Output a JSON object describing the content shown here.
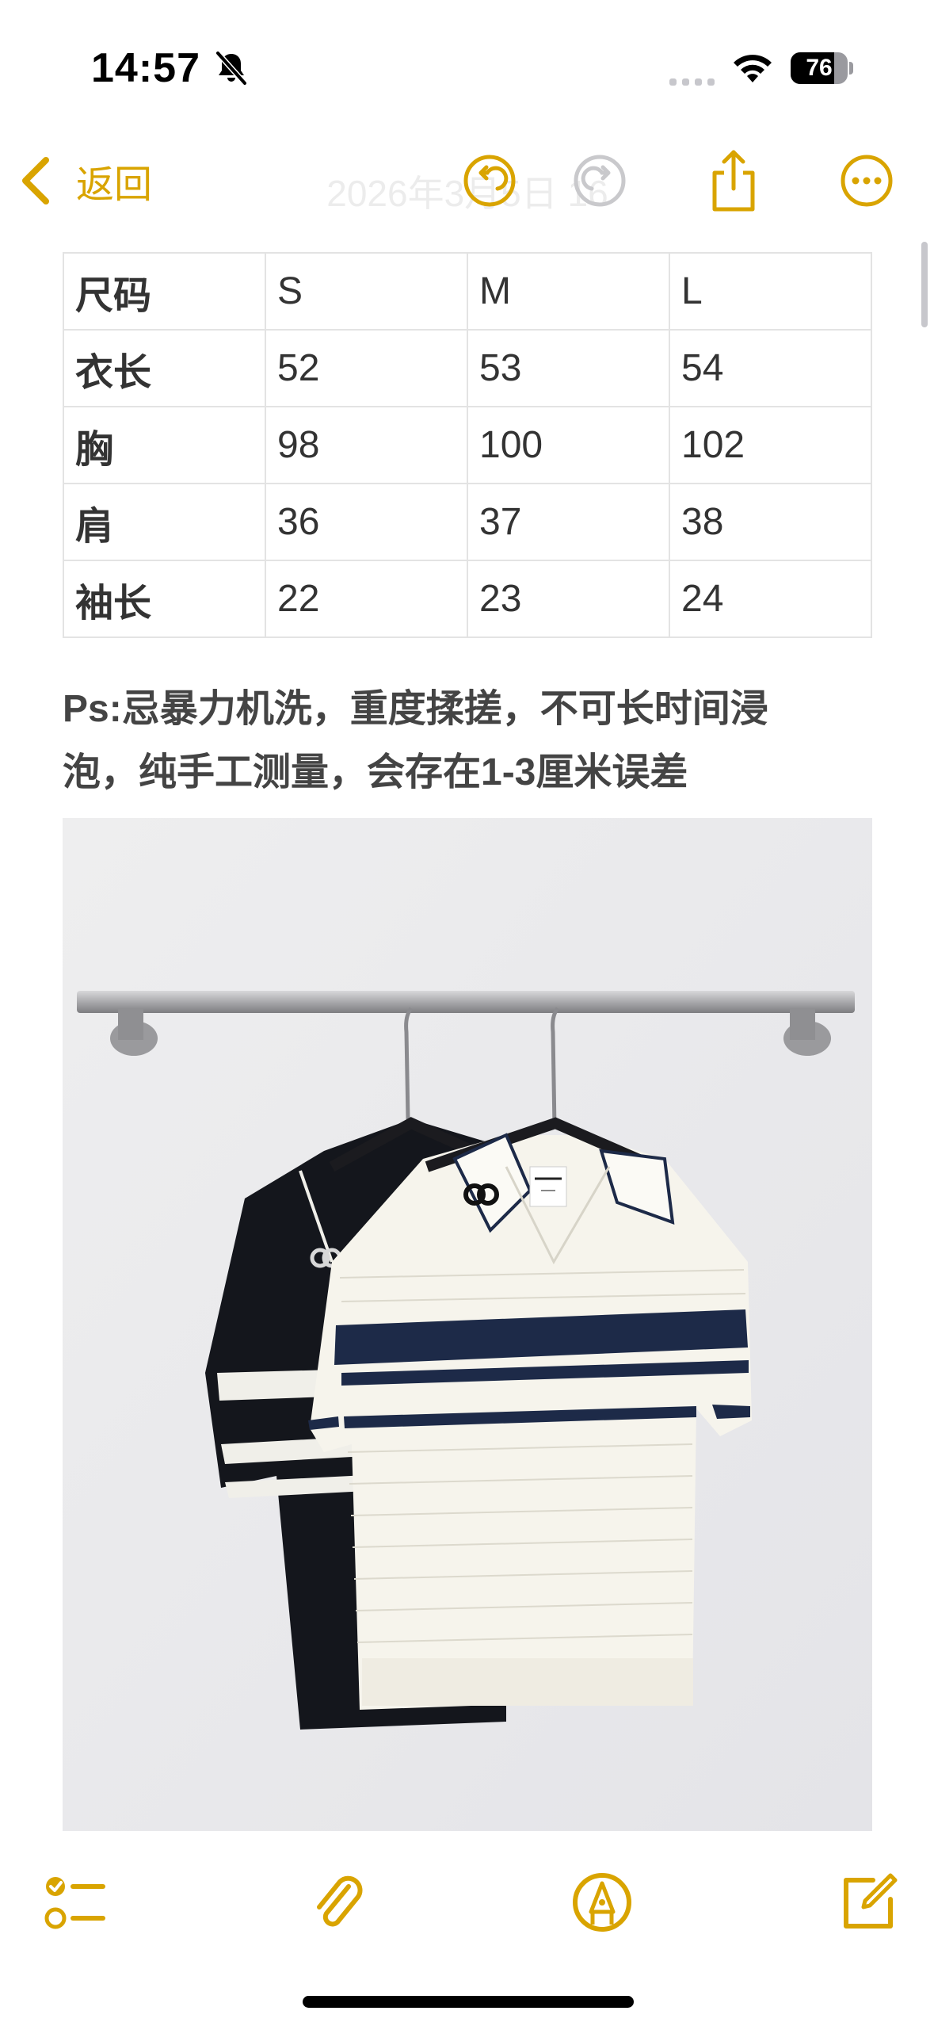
{
  "status_bar": {
    "time": "14:57",
    "battery_level": "76",
    "battery_fraction": 0.76
  },
  "nav": {
    "back_label": "返回",
    "title": "2026年3月5日 16",
    "accent_color": "#d9a400"
  },
  "size_table": {
    "header": [
      "尺码",
      "S",
      "M",
      "L"
    ],
    "rows": [
      [
        "衣长",
        "52",
        "53",
        "54"
      ],
      [
        "胸",
        "98",
        "100",
        "102"
      ],
      [
        "肩",
        "36",
        "37",
        "38"
      ],
      [
        "袖长",
        "22",
        "23",
        "24"
      ]
    ]
  },
  "note": {
    "line1": "Ps:忌暴力机洗，重度揉搓，不可长时间浸",
    "line2": "泡，纯手工测量，会存在1-3厘米误差"
  },
  "photo": {
    "icon": "photo-of-two-striped-knit-polo-shirts-on-hangers"
  },
  "icons": {
    "bell": "bell-slash-icon",
    "signal": "cellular-signal-icon",
    "wifi": "wifi-icon",
    "back": "chevron-left-icon",
    "undo": "undo-icon",
    "redo": "redo-icon",
    "share": "share-icon",
    "more": "ellipsis-circle-icon",
    "checklist": "checklist-icon",
    "attach": "paperclip-icon",
    "markup": "pen-tip-circle-icon",
    "compose": "compose-icon"
  }
}
